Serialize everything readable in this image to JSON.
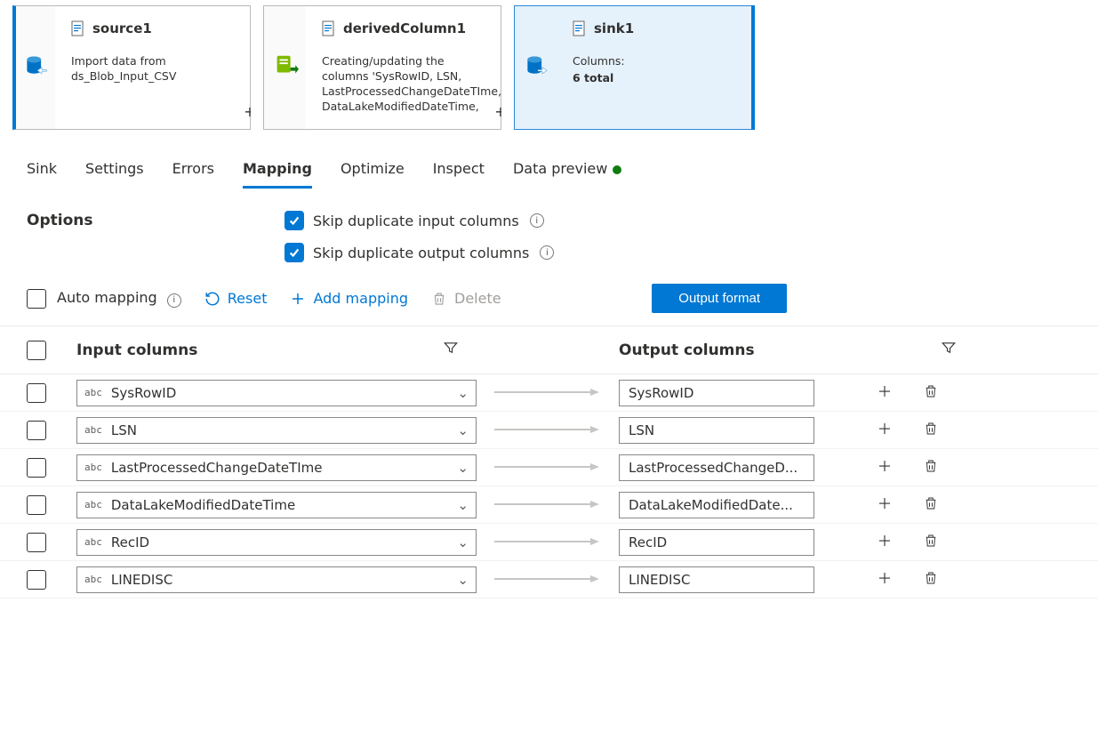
{
  "flow_nodes": [
    {
      "title": "source1",
      "description": "Import data from ds_Blob_Input_CSV",
      "icon": "database-in"
    },
    {
      "title": "derivedColumn1",
      "description": "Creating/updating the columns 'SysRowID, LSN, LastProcessedChangeDateTIme, DataLakeModifiedDateTime,",
      "icon": "script"
    },
    {
      "title": "sink1",
      "columns_label": "Columns:",
      "columns_value": "6 total",
      "icon": "database-out",
      "selected": true
    }
  ],
  "tabs": [
    "Sink",
    "Settings",
    "Errors",
    "Mapping",
    "Optimize",
    "Inspect",
    "Data preview"
  ],
  "active_tab": "Mapping",
  "preview_live": true,
  "options": {
    "heading": "Options",
    "skip_dup_input": "Skip duplicate input columns",
    "skip_dup_output": "Skip duplicate output columns"
  },
  "toolbar": {
    "auto_mapping": "Auto mapping",
    "reset": "Reset",
    "add_mapping": "Add mapping",
    "delete": "Delete",
    "output_format": "Output format"
  },
  "table": {
    "input_header": "Input columns",
    "output_header": "Output columns",
    "type_label": "abc",
    "rows": [
      {
        "input": "SysRowID",
        "output": "SysRowID"
      },
      {
        "input": "LSN",
        "output": "LSN"
      },
      {
        "input": "LastProcessedChangeDateTIme",
        "output": "LastProcessedChangeD..."
      },
      {
        "input": "DataLakeModifiedDateTime",
        "output": "DataLakeModifiedDate..."
      },
      {
        "input": "RecID",
        "output": "RecID"
      },
      {
        "input": "LINEDISC",
        "output": "LINEDISC"
      }
    ]
  }
}
